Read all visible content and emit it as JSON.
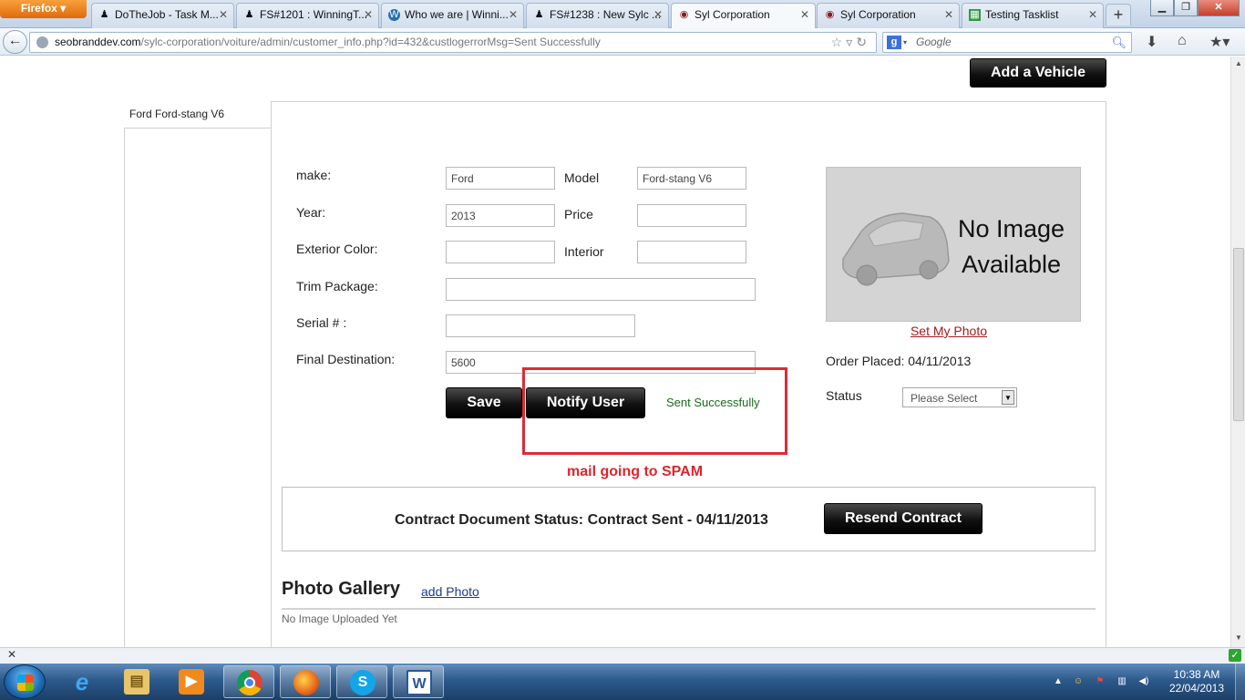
{
  "browser": {
    "firefox_button": "Firefox",
    "tabs": [
      {
        "label": "DoTheJob - Task M...",
        "icon": "person-icon"
      },
      {
        "label": "FS#1201 : WinningT...",
        "icon": "person-icon"
      },
      {
        "label": "Who we are | Winni...",
        "icon": "wordpress-icon"
      },
      {
        "label": "FS#1238 : New Sylc ...",
        "icon": "person-icon"
      },
      {
        "label": "Syl Corporation",
        "icon": "syl-icon",
        "active": true
      },
      {
        "label": "Syl Corporation",
        "icon": "syl-icon"
      },
      {
        "label": "Testing Tasklist",
        "icon": "spreadsheet-icon"
      }
    ],
    "url_host": "seobranddev.com",
    "url_path": "/sylc-corporation/voiture/admin/customer_info.php?id=432&custlogerrorMsg=Sent Successfully",
    "search_placeholder": "Google"
  },
  "page": {
    "add_vehicle_button": "Add a Vehicle",
    "vehicle_tab": "Ford Ford-stang V6",
    "form": {
      "make_label": "make:",
      "make_value": "Ford",
      "model_label": "Model",
      "model_value": "Ford-stang V6",
      "year_label": "Year:",
      "year_value": "2013",
      "price_label": "Price",
      "price_value": "",
      "exterior_label": "Exterior Color:",
      "exterior_value": "",
      "interior_label": "Interior",
      "interior_value": "",
      "trim_label": "Trim Package:",
      "trim_value": "",
      "serial_label": "Serial # :",
      "serial_value": "",
      "destination_label": "Final Destination:",
      "destination_value": "5600"
    },
    "save_button": "Save",
    "notify_button": "Notify User",
    "sent_message": "Sent Successfully",
    "annotation": "mail going to SPAM",
    "photo": {
      "no_image_line1": "No Image",
      "no_image_line2": "Available",
      "set_photo_link": "Set My Photo"
    },
    "order_placed": "Order Placed: 04/11/2013",
    "status_label": "Status",
    "status_select": "Please Select",
    "contract_status": "Contract Document Status: Contract Sent - 04/11/2013",
    "resend_button": "Resend Contract",
    "gallery_title": "Photo Gallery",
    "add_photo_link": "add Photo",
    "no_upload": "No Image Uploaded Yet"
  },
  "taskbar": {
    "time": "10:38 AM",
    "date": "22/04/2013",
    "apps": [
      "start-button",
      "internet-explorer",
      "file-explorer",
      "media-player",
      "chrome",
      "firefox",
      "skype",
      "word"
    ]
  },
  "colors": {
    "annotation_red": "#dd2b37",
    "success_green": "#1a6b1a",
    "link_red": "#a21a1a",
    "link_blue": "#1a3a8c"
  }
}
